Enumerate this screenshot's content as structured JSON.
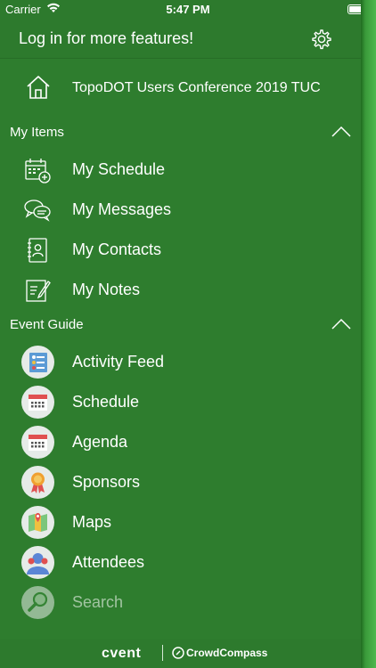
{
  "status_bar": {
    "carrier": "Carrier",
    "time": "5:47 PM"
  },
  "header": {
    "title": "Log in for more features!"
  },
  "home": {
    "label": "TopoDOT Users Conference 2019 TUC",
    "icon": "home-icon"
  },
  "my_items": {
    "title": "My Items",
    "items": [
      {
        "label": "My Schedule",
        "icon": "calendar-add-icon"
      },
      {
        "label": "My Messages",
        "icon": "chat-bubbles-icon"
      },
      {
        "label": "My Contacts",
        "icon": "address-book-icon"
      },
      {
        "label": "My Notes",
        "icon": "note-edit-icon"
      }
    ]
  },
  "event_guide": {
    "title": "Event Guide",
    "items": [
      {
        "label": "Activity Feed",
        "icon": "activity-feed-icon"
      },
      {
        "label": "Schedule",
        "icon": "calendar-icon"
      },
      {
        "label": "Agenda",
        "icon": "calendar-icon"
      },
      {
        "label": "Sponsors",
        "icon": "ribbon-badge-icon"
      },
      {
        "label": "Maps",
        "icon": "map-icon"
      },
      {
        "label": "Attendees",
        "icon": "people-icon"
      },
      {
        "label": "Search",
        "icon": "search-icon"
      }
    ]
  },
  "footer": {
    "brand_primary": "cvent",
    "brand_secondary": "CrowdCompass"
  },
  "colors": {
    "primary_green": "#2e7d2e",
    "header_green": "#2d7a2d",
    "accent_light": "#4fb84f"
  }
}
